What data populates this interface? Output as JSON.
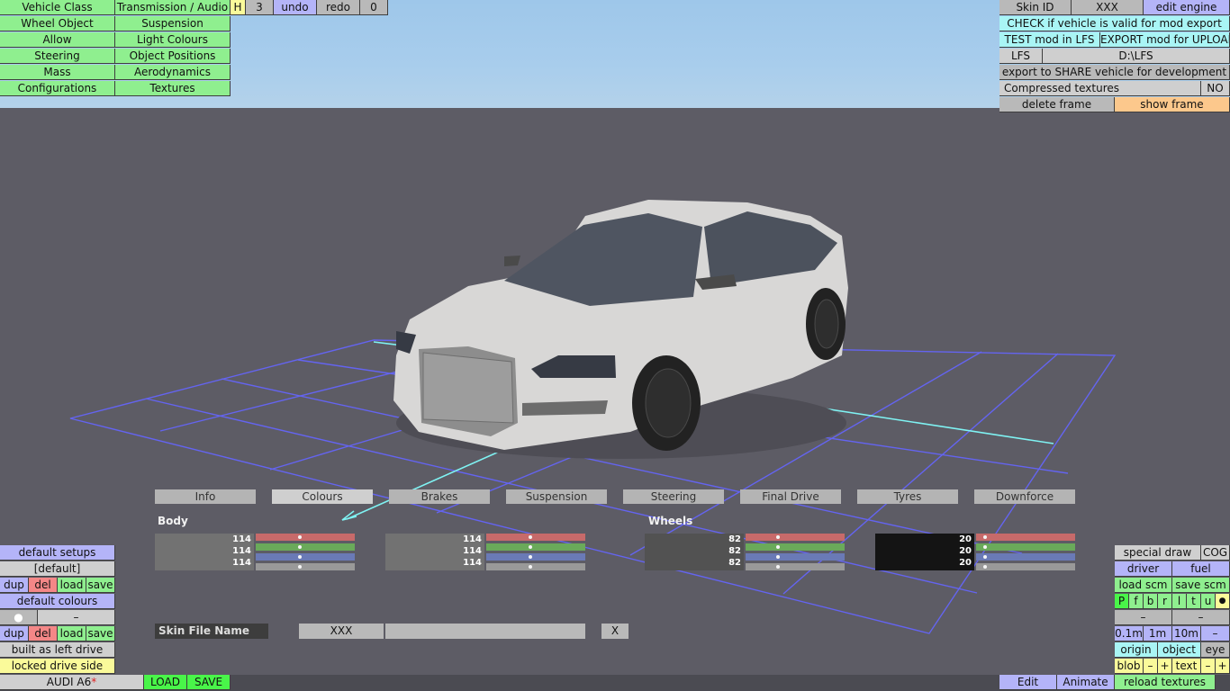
{
  "menu": {
    "vehicle_class": "Vehicle Class",
    "transmission": "Transmission / Audio",
    "h": "H",
    "three": "3",
    "undo": "undo",
    "redo": "redo",
    "zero": "0",
    "wheel_object": "Wheel Object",
    "suspension": "Suspension",
    "allow": "Allow",
    "light_colours": "Light Colours",
    "steering": "Steering",
    "object_positions": "Object Positions",
    "mass": "Mass",
    "aerodynamics": "Aerodynamics",
    "configurations": "Configurations",
    "textures": "Textures"
  },
  "topright": {
    "skin_id_label": "Skin ID",
    "skin_id_value": "XXX",
    "edit_engine": "edit engine",
    "check_valid": "CHECK if vehicle is valid for mod export",
    "test_mod": "TEST mod in LFS",
    "export_mod": "EXPORT mod for UPLOAD",
    "lfs_label": "LFS",
    "lfs_path": "D:\\LFS",
    "export_share": "export to SHARE vehicle for development",
    "compressed_label": "Compressed textures",
    "compressed_value": "NO",
    "delete_frame": "delete frame",
    "show_frame": "show frame"
  },
  "tabs": [
    "Info",
    "Colours",
    "Brakes",
    "Suspension",
    "Steering",
    "Final Drive",
    "Tyres",
    "Downforce"
  ],
  "colours": {
    "body_label": "Body",
    "wheels_label": "Wheels",
    "body": [
      "114",
      "114",
      "114"
    ],
    "body2": [
      "114",
      "114",
      "114"
    ],
    "wheels": [
      "82",
      "82",
      "82"
    ],
    "wheels2": [
      "20",
      "20",
      "20"
    ],
    "body_fill": 0.447,
    "wheels_fill": 0.322,
    "wheels2_fill": 0.078
  },
  "skin": {
    "label": "Skin File Name",
    "value": "XXX",
    "x": "X"
  },
  "leftpanel": {
    "default_setups": "default setups",
    "default_item": "[default]",
    "dup": "dup",
    "del": "del",
    "load": "load",
    "save": "save",
    "default_colours": "default colours",
    "dot": "●",
    "dash": "–",
    "built_left": "built as left drive",
    "locked_side": "locked drive side"
  },
  "rightpanel": {
    "special_draw": "special draw",
    "cog": "COG",
    "driver": "driver",
    "fuel": "fuel",
    "load_scm": "load scm",
    "save_scm": "save scm",
    "letters": [
      "P",
      "f",
      "b",
      "r",
      "l",
      "t",
      "u",
      "●"
    ],
    "dash": "–",
    "m01": "0.1m",
    "m1": "1m",
    "m10": "10m",
    "origin": "origin",
    "object": "object",
    "eye": "eye",
    "blob": "blob",
    "minus": "–",
    "plus": "+",
    "text": "text",
    "reload_textures": "reload textures"
  },
  "bottom": {
    "car_name": "AUDI A6",
    "star": "*",
    "load": "LOAD",
    "save": "SAVE",
    "edit": "Edit",
    "animate": "Animate"
  },
  "colors": {
    "green": "#8fef8f",
    "purple": "#b4b4f8",
    "cyan": "#a9f5f5",
    "yellow": "#fafa9a",
    "orange": "#fcc88c",
    "red": "#f48787",
    "grid": "#5a5af0"
  }
}
